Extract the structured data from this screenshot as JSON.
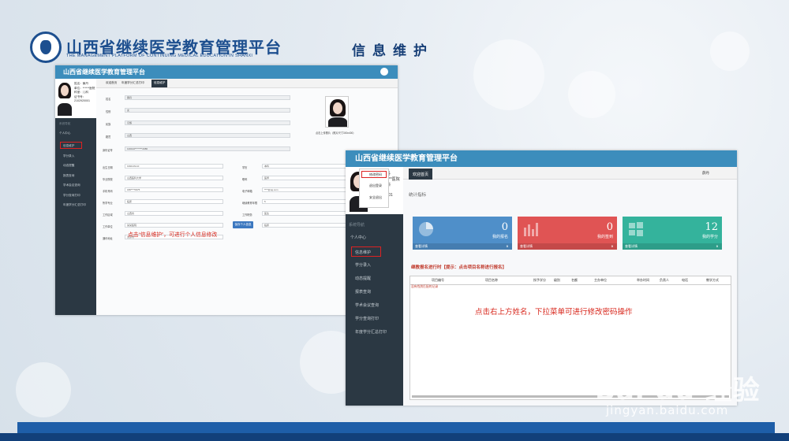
{
  "slide": {
    "title": "山西省继续医学教育管理平台",
    "subtitle": "THE MANAGEMENT PLATFORM OF CONTINUING MEDICAL EDUCATION IN SHANXI",
    "heading": "信息维护"
  },
  "shot1": {
    "app_title": "山西省继续医学教育管理平台",
    "user": {
      "name": "姓名：薛丹",
      "unit": "单位：******医院",
      "dept": "科室：儿科",
      "cert_label": "证书号：",
      "cert_no": "2102920001"
    },
    "sidebar": {
      "section": "系统导航",
      "group": "个人中心",
      "items": [
        "信息维护",
        "学分录入",
        "动态提醒",
        "报表查询",
        "学术会议查询",
        "学分查询打印",
        "年度学分汇总打印"
      ]
    },
    "tabs": [
      "欢迎首页",
      "年度学分汇总打印",
      "信息维护"
    ],
    "form": {
      "rows": [
        {
          "label": "姓名",
          "value": "薛丹"
        },
        {
          "label": "性别",
          "value": "女"
        },
        {
          "label": "民族",
          "value": "汉族"
        },
        {
          "label": "籍贯",
          "value": "山西"
        },
        {
          "label": "身份证号",
          "value": "140102********2086"
        }
      ],
      "left2": [
        {
          "label": "出生日期",
          "value": "1990-09-10"
        },
        {
          "label": "毕业院校",
          "value": "山西医科大学"
        },
        {
          "label": "手机号码",
          "value": "186****0975"
        },
        {
          "label": "所学专业",
          "value": "临床"
        },
        {
          "label": "工作区域",
          "value": "山西省"
        },
        {
          "label": "工作单位",
          "value": "某某医院"
        },
        {
          "label": "通讯地址",
          "value": "太原市"
        }
      ],
      "right2": [
        {
          "label": "学历",
          "value": "本科"
        },
        {
          "label": "职称",
          "value": "医师"
        },
        {
          "label": "电子邮箱",
          "value": "****@qq.com"
        },
        {
          "label": "继续教育年限",
          "value": "5"
        },
        {
          "label": "工作职务",
          "value": "医生"
        },
        {
          "label": "执业类别",
          "value": "临床"
        }
      ],
      "save_button": "保存个人信息",
      "photo_caption": "点击上传照片（照片尺寸300x400）",
      "note": "点击“信息维护”，可进行个人信息修改"
    }
  },
  "shot2": {
    "app_title": "山西省继续医学教育管理平台",
    "user": {
      "name": "姓名：薛丹",
      "unit": "单位：******医院",
      "dept": "科室：儿科",
      "cert_label": "证书号：",
      "cert_no": "2102920001"
    },
    "sidebar": {
      "section": "系统导航",
      "group": "个人中心",
      "items": [
        "信息维护",
        "学分录入",
        "动态提醒",
        "报表查询",
        "学术会议查询",
        "学分查询打印",
        "年度学分汇总打印"
      ]
    },
    "tab": "欢迎首页",
    "topright_user": "薛丹",
    "dropdown": [
      "修改密码",
      "退出登录",
      "安全退出"
    ],
    "dashboard_label": "统计指标",
    "cards": [
      {
        "value": "0",
        "label": "我的报名",
        "foot": "查看详情",
        "foot_value": "0",
        "color": "#4f8fc9"
      },
      {
        "value": "0",
        "label": "我的签到",
        "foot": "查看详情",
        "foot_value": "0",
        "color": "#e05454"
      },
      {
        "value": "12",
        "label": "我的学分",
        "foot": "查看详情",
        "foot_value": "0",
        "color": "#34b39c"
      }
    ],
    "list_header": "继教报名进行时【提示：点击项目名称进行报名】",
    "table_headers": [
      "项目编号",
      "项目名称",
      "授予学分",
      "级别",
      "名额",
      "主办单位",
      "举办时间",
      "负责人",
      "电话",
      "教学方式"
    ],
    "empty_row": "没有找到匹配的记录",
    "note": "点击右上方姓名，下拉菜单可进行修改密码操作"
  },
  "watermark": {
    "brand": "Bai du 经验",
    "url": "jingyan.baidu.com"
  }
}
